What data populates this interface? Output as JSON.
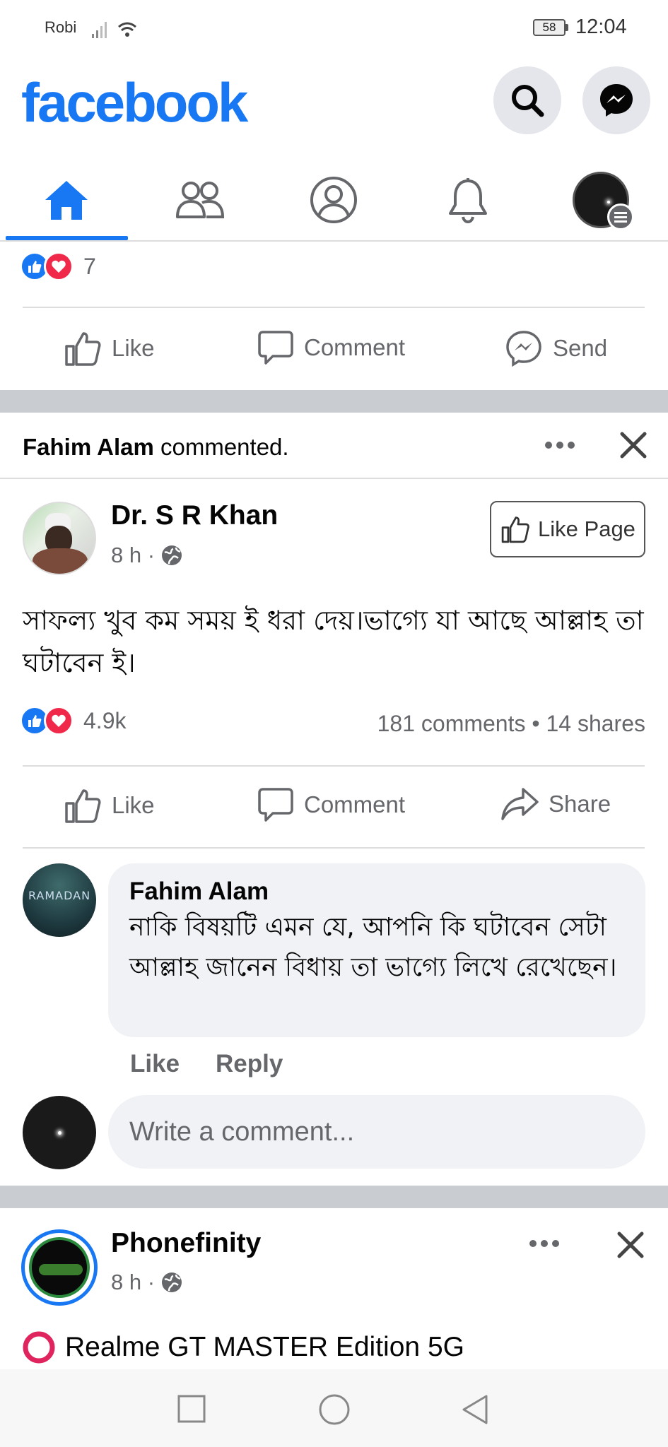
{
  "status_bar": {
    "carrier": "Robi",
    "battery": "58",
    "time": "12:04"
  },
  "header": {
    "logo": "facebook"
  },
  "nav_tabs": [
    "home",
    "friends",
    "profile",
    "notifications",
    "menu"
  ],
  "prev_post": {
    "reaction_count": "7",
    "actions": {
      "like": "Like",
      "comment": "Comment",
      "send": "Send"
    }
  },
  "activity": {
    "actor": "Fahim Alam",
    "verb": "commented."
  },
  "post": {
    "author": "Dr. S R Khan",
    "time": "8 h ·",
    "like_page": "Like Page",
    "text": "সাফল্য খুব কম সময় ই ধরা দেয়।ভাগ্যে যা আছে আল্লাহ তা ঘটাবেন ই।",
    "reaction_count": "4.9k",
    "stats": "181 comments • 14 shares",
    "actions": {
      "like": "Like",
      "comment": "Comment",
      "share": "Share"
    },
    "comment": {
      "author": "Fahim Alam",
      "avatar_text": "RAMADAN",
      "text": "নাকি বিষয়টি এমন যে, আপনি কি ঘটাবেন সেটা আল্লাহ জানেন বিধায় তা ভাগ্যে লিখে রেখেছেন।",
      "like": "Like",
      "reply": "Reply"
    },
    "write_placeholder": "Write a comment..."
  },
  "next_post": {
    "author": "Phonefinity",
    "time": "8 h ·",
    "text": "Realme GT MASTER Edition 5G"
  },
  "colors": {
    "brand": "#1877f2",
    "love": "#f0284a",
    "muted": "#65676b"
  }
}
